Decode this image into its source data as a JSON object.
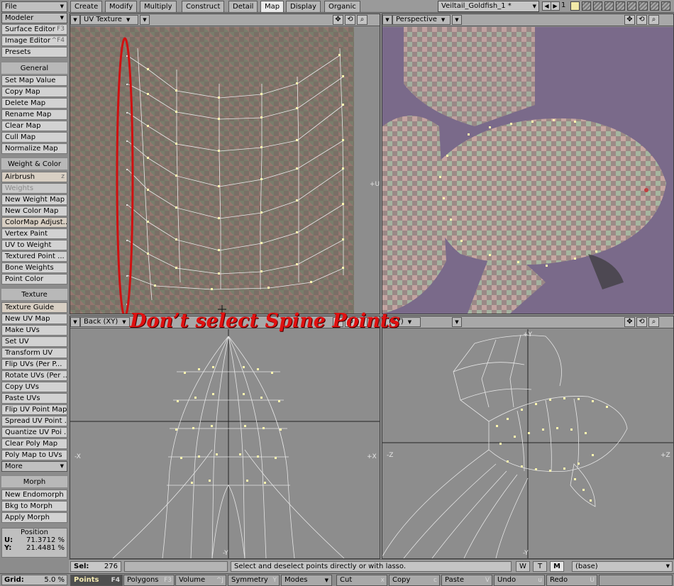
{
  "top_tabs": [
    "Create",
    "Modify",
    "Multiply",
    "Construct",
    "Detail",
    "Map",
    "Display",
    "Organic"
  ],
  "active_tab": "Map",
  "object_select": "Veiltail_Goldfish_1 *",
  "layer_number": "1",
  "sidebar": {
    "file": "File",
    "modeler": "Modeler",
    "surface_editor": "Surface Editor",
    "surface_editor_key": "F3",
    "image_editor": "Image Editor",
    "image_editor_key": "^F4",
    "presets": "Presets",
    "general_header": "General",
    "general": [
      "Set Map Value",
      "Copy Map",
      "Delete Map",
      "Rename Map",
      "Clear Map",
      "Cull Map",
      "Normalize Map"
    ],
    "weight_color_header": "Weight & Color",
    "airbrush": "Airbrush",
    "airbrush_key": "z",
    "weights": "Weights",
    "weight_color": [
      "New Weight Map",
      "New Color Map",
      "ColorMap Adjust...",
      "Vertex Paint",
      "UV to Weight",
      "Textured Point ...",
      "Bone Weights",
      "Point Color"
    ],
    "texture_header": "Texture",
    "texture": [
      "Texture Guide",
      "New UV Map",
      "Make UVs",
      "Set UV",
      "Transform UV",
      "Flip UVs (Per P...",
      "Rotate UVs (Per ...",
      "Copy UVs",
      "Paste UVs",
      "Flip UV Point Map",
      "Spread UV Point ...",
      "Quantize UV Poi ...",
      "Clear Poly Map",
      "Poly Map to UVs"
    ],
    "more": "More",
    "morph_header": "Morph",
    "morph": [
      "New Endomorph",
      "Bkg to Morph",
      "Apply Morph"
    ],
    "position_title": "Position",
    "position_u_label": "U:",
    "position_u": "71.3712 %",
    "position_v_label": "Y:",
    "position_v": "21.4481 %"
  },
  "viewports": {
    "uv_title": "UV Texture",
    "uv_axis": "+U",
    "perspective_title": "Perspective",
    "back_title": "Back",
    "back_axes": "(XY)",
    "back_labels": {
      "left": "-X",
      "right": "+X",
      "bottom": "-Y"
    },
    "side_axes": "(ZY)",
    "side_labels": {
      "left": "-Z",
      "right": "+Z",
      "top": "+Y",
      "bottom": "-Y"
    }
  },
  "annotation": "Don’t select Spine Points",
  "status": {
    "sel_label": "Sel:",
    "sel_count": "276",
    "hint": "Select and deselect points directly or with lasso.",
    "wtm": [
      "W",
      "T",
      "M"
    ],
    "wtm_active": "M",
    "base": "(base)"
  },
  "bottom": {
    "grid_label": "Grid:",
    "grid_value": "5.0 %",
    "modes": [
      {
        "label": "Points",
        "key": "F4"
      },
      {
        "label": "Polygons",
        "key": "F3"
      },
      {
        "label": "Volume",
        "key": "^J"
      }
    ],
    "symmetry": "Symmetry",
    "symmetry_key": "Y",
    "modes_menu": "Modes",
    "actions": [
      {
        "label": "Cut",
        "key": "x"
      },
      {
        "label": "Copy",
        "key": "c"
      },
      {
        "label": "Paste",
        "key": "V"
      },
      {
        "label": "Undo",
        "key": "u"
      },
      {
        "label": "Redo",
        "key": "U"
      }
    ]
  },
  "colors": {
    "annotation": "#e01010",
    "selected_point": "#fff7b0",
    "perspective_bg": "#7a6a8a"
  }
}
